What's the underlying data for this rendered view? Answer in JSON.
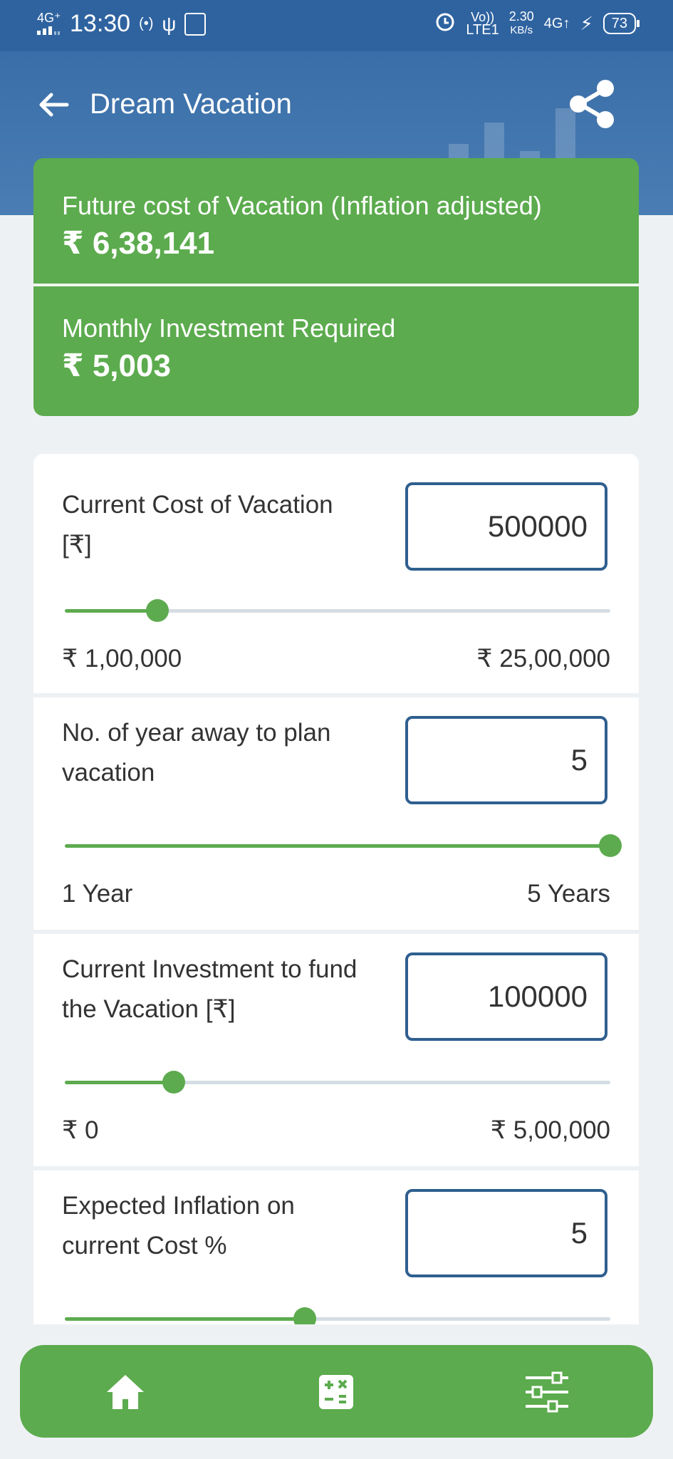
{
  "status_bar": {
    "network": "4G⁺",
    "time": "13:30",
    "volte": "Vo))",
    "lte": "LTE1",
    "speed_value": "2.30",
    "speed_unit": "KB/s",
    "network2": "4G↑",
    "battery": "73"
  },
  "header": {
    "title": "Dream Vacation",
    "back_icon": "arrow-left-icon",
    "share_icon": "share-icon"
  },
  "results": {
    "future_cost_label": "Future cost of Vacation (Inflation adjusted)",
    "future_cost_value": "₹ 6,38,141",
    "monthly_label": "Monthly Investment Required",
    "monthly_value": "₹ 5,003"
  },
  "fields": [
    {
      "label": "Current Cost of Vacation [₹]",
      "value": "500000",
      "min_label": "₹ 1,00,000",
      "max_label": "₹ 25,00,000",
      "slider_fraction": 0.17
    },
    {
      "label": "No. of year away to plan vacation",
      "value": "5",
      "min_label": "1 Year",
      "max_label": "5 Years",
      "slider_fraction": 1.0
    },
    {
      "label": "Current Investment to fund the Vacation [₹]",
      "value": "100000",
      "min_label": "₹ 0",
      "max_label": "₹ 5,00,000",
      "slider_fraction": 0.2
    },
    {
      "label": "Expected Inflation on current Cost %",
      "value": "5",
      "slider_fraction": 0.44
    }
  ],
  "bottom_nav": {
    "items": [
      "home-icon",
      "calculator-icon",
      "sliders-icon"
    ]
  },
  "colors": {
    "header_blue": "#2f63a0",
    "accent_green": "#5cab4e",
    "input_border": "#2f5f8f"
  }
}
